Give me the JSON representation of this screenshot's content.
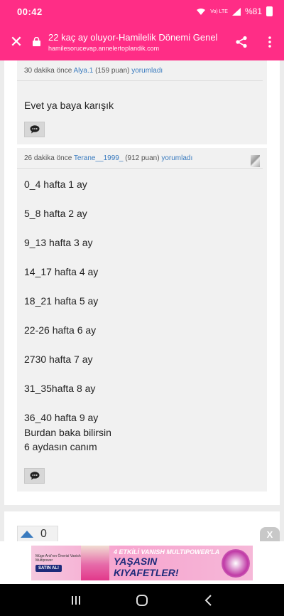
{
  "status_bar": {
    "time": "00:42",
    "network": "Vo) LTE",
    "battery": "%81"
  },
  "toolbar": {
    "title": "22 kaç ay oluyor-Hamilelik Dönemi Genel",
    "url": "hamilesorucevap.annelertoplandik.com"
  },
  "comments": [
    {
      "time": "30 dakika önce",
      "user": "Alya.1",
      "points": "(159 puan)",
      "action": "yorumladı",
      "lines": [
        "Evet ya baya karışık"
      ]
    },
    {
      "time": "26 dakika önce",
      "user": "Terane__1999_",
      "points": "(912 puan)",
      "action": "yorumladı",
      "lines": [
        "0_4 hafta 1 ay",
        "5_8 hafta 2 ay",
        "9_13 hafta 3 ay",
        "14_17 hafta 4 ay",
        "18_21 hafta 5 ay",
        "22-26 hafta 6 ay",
        "2730 hafta 7 ay",
        "31_35hafta 8 ay",
        "36_40 hafta 9 ay",
        "Burdan baka bilirsin",
        "6 aydasın canım"
      ]
    }
  ],
  "vote": {
    "count": "0"
  },
  "ad": {
    "small_text": "Müge Anlı'nın Önerisi Vanish Multipower",
    "button": "SATIN AL!",
    "line1": "4 ETKİLİ VANISH MULTIPOWER'LA",
    "line2": "YAŞASIN KIYAFETLER!",
    "close": "X"
  },
  "colors": {
    "brand": "#ff2d86",
    "link": "#3a7bbf"
  }
}
